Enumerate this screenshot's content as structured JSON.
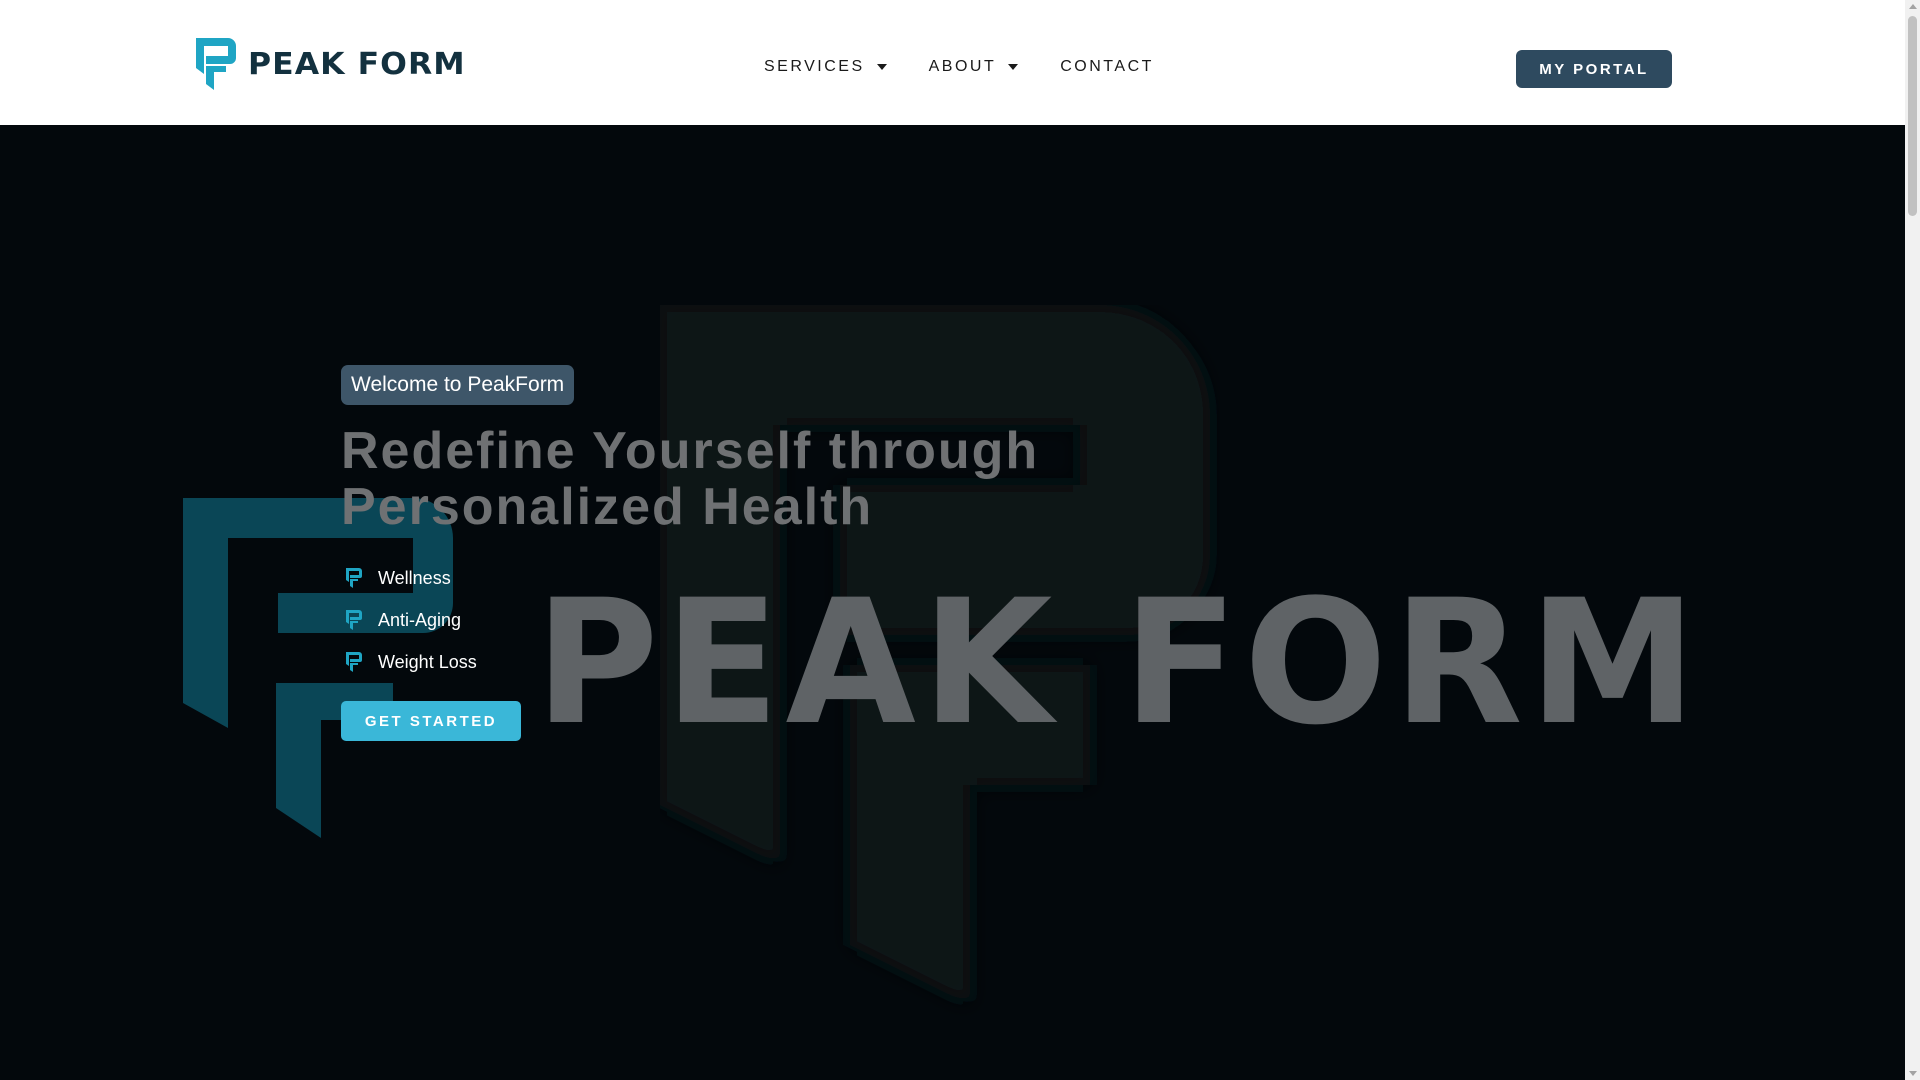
{
  "brand": {
    "name": "PEAK FORM"
  },
  "nav": {
    "items": [
      {
        "label": "SERVICES",
        "has_dropdown": true
      },
      {
        "label": "ABOUT",
        "has_dropdown": true
      },
      {
        "label": "CONTACT",
        "has_dropdown": false
      }
    ],
    "portal_label": "MY PORTAL"
  },
  "hero": {
    "badge": "Welcome to PeakForm",
    "headline": "Redefine Yourself through Personalized Health",
    "features": [
      "Wellness",
      "Anti-Aging",
      "Weight Loss"
    ],
    "cta_label": "GET STARTED",
    "wordmark": "PEAK FORM"
  },
  "colors": {
    "brand_teal": "#1fa5c4",
    "brand_navy": "#13313f",
    "portal_button": "#2e4a5f",
    "cta_button": "#3ab7d8",
    "badge_bg": "#3e5669",
    "hero_bg": "#03080c",
    "wordmark_gray": "#5f6366"
  },
  "icons": {
    "logo": "pf-logo-icon",
    "feature_bullet": "pf-bullet-icon",
    "dropdown": "caret-down-icon"
  }
}
